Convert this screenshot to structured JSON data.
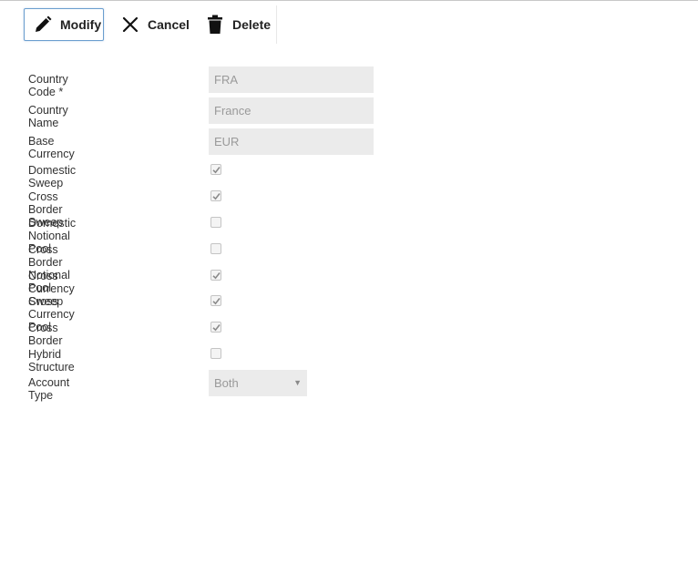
{
  "toolbar": {
    "modify_label": "Modify",
    "cancel_label": "Cancel",
    "delete_label": "Delete"
  },
  "form": {
    "country_code": {
      "label": "Country Code *",
      "value": "FRA"
    },
    "country_name": {
      "label": "Country Name",
      "value": "France"
    },
    "base_currency": {
      "label": "Base Currency",
      "value": "EUR"
    },
    "checkboxes": [
      {
        "label": "Domestic Sweep",
        "checked": true
      },
      {
        "label": "Cross Border Sweep",
        "checked": true
      },
      {
        "label": "Domestic Notional Pool",
        "checked": false
      },
      {
        "label": "Cross Border Notional Pool",
        "checked": false
      },
      {
        "label": "Cross Currency Sweep",
        "checked": true
      },
      {
        "label": "Cross Currency Pool",
        "checked": true
      },
      {
        "label": "Cross Border",
        "checked": true
      },
      {
        "label": "Hybrid Structure",
        "checked": false
      }
    ],
    "account_type": {
      "label": "Account Type",
      "selected": "Both"
    }
  },
  "colors": {
    "field_bg": "#ebebeb",
    "field_text": "#9a9a9a",
    "modify_border": "#6a9ecf"
  }
}
